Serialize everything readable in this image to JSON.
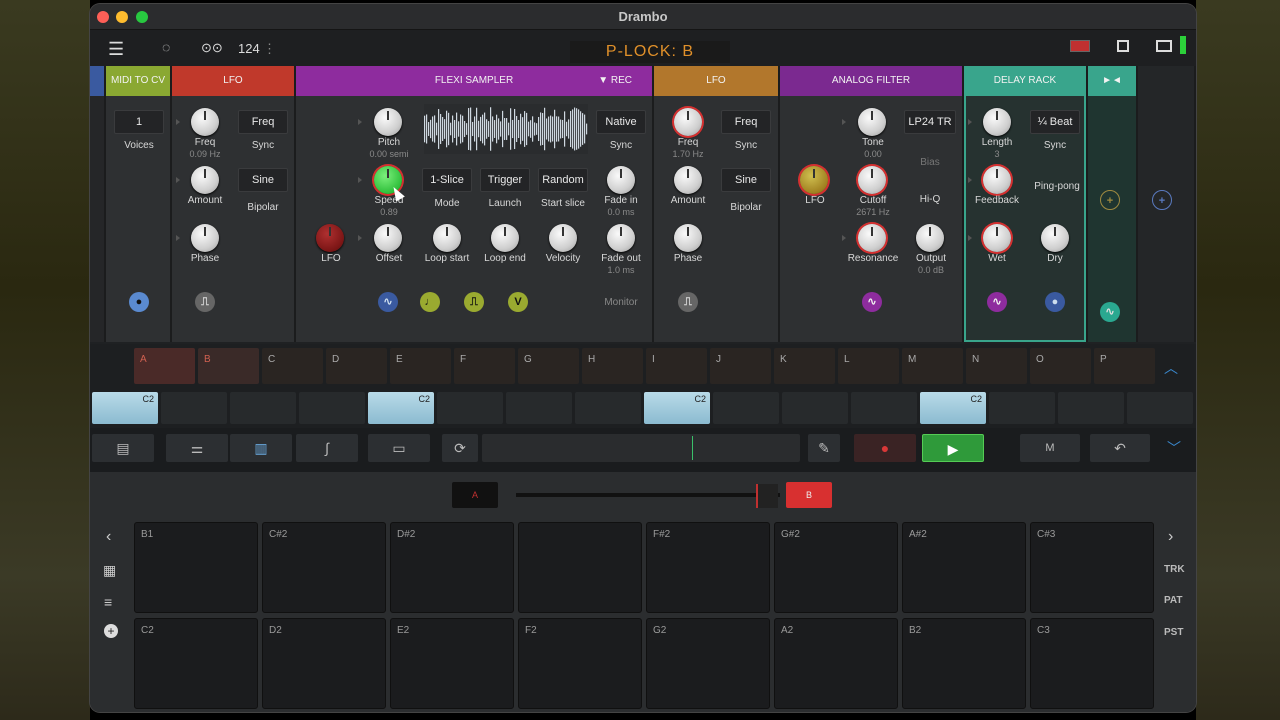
{
  "window": {
    "title": "Drambo"
  },
  "topbar": {
    "tempo": "124",
    "tempo_more": "⋮",
    "plock": "P-LOCK: B"
  },
  "modules": {
    "midi_cv": {
      "title": "MIDI TO CV",
      "voices_value": "1",
      "voices_label": "Voices"
    },
    "lfo1": {
      "title": "LFO",
      "freq": "Freq",
      "freq_val": "0.09 Hz",
      "freq_btn": "Freq",
      "sync": "Sync",
      "amount": "Amount",
      "wave": "Sine",
      "bipolar": "Bipolar",
      "phase": "Phase"
    },
    "sampler": {
      "title": "FLEXI SAMPLER",
      "rec": "▼ Rec",
      "pitch": "Pitch",
      "pitch_val": "0.00 semi",
      "speed": "Speed",
      "speed_val": "0.89",
      "lfo": "LFO",
      "offset": "Offset",
      "loop_start": "Loop start",
      "loop_end": "Loop end",
      "velocity": "Velocity",
      "native": "Native",
      "sync": "Sync",
      "slice": "1-Slice",
      "mode": "Mode",
      "trigger": "Trigger",
      "launch": "Launch",
      "random": "Random",
      "start_slice": "Start slice",
      "fade_in": "Fade in",
      "fade_in_val": "0.0 ms",
      "fade_out": "Fade out",
      "fade_out_val": "1.0 ms",
      "monitor": "Monitor",
      "v_dot": "V"
    },
    "lfo2": {
      "title": "LFO",
      "freq": "Freq",
      "freq_val": "1.70 Hz",
      "freq_btn": "Freq",
      "sync": "Sync",
      "amount": "Amount",
      "wave": "Sine",
      "bipolar": "Bipolar",
      "phase": "Phase"
    },
    "filter": {
      "title": "ANALOG FILTER",
      "lfo": "LFO",
      "tone": "Tone",
      "tone_val": "0.00",
      "type": "LP24 TR",
      "bias": "Bias",
      "cutoff": "Cutoff",
      "cutoff_val": "2671 Hz",
      "hiq": "Hi-Q",
      "resonance": "Resonance",
      "output": "Output",
      "output_val": "0.0 dB"
    },
    "delay": {
      "title": "DELAY RACK",
      "length": "Length",
      "length_val": "3",
      "beat": "¼ Beat",
      "sync": "Sync",
      "feedback": "Feedback",
      "pingpong": "Ping-pong",
      "wet": "Wet",
      "dry": "Dry"
    },
    "extra": {
      "title": "►◄"
    }
  },
  "patterns": [
    "A",
    "B",
    "C",
    "D",
    "E",
    "F",
    "G",
    "H",
    "I",
    "J",
    "K",
    "L",
    "M",
    "N",
    "O",
    "P"
  ],
  "clips": {
    "note": "C2"
  },
  "crossfader": {
    "a": "A",
    "b": "B"
  },
  "pads": {
    "row1": [
      "B1",
      "C#2",
      "D#2",
      "",
      "F#2",
      "G#2",
      "A#2",
      "C#3"
    ],
    "row2": [
      "C2",
      "D2",
      "E2",
      "F2",
      "G2",
      "A2",
      "B2",
      "C3"
    ]
  },
  "side": {
    "trk": "TRK",
    "pat": "PAT",
    "pst": "PST"
  },
  "colors": {
    "midi": "#8aa832",
    "lfo": "#c0392b",
    "sampler": "#8e2c9e",
    "lfo2": "#b2772c",
    "filter": "#7b2990",
    "delay": "#39a58c"
  }
}
